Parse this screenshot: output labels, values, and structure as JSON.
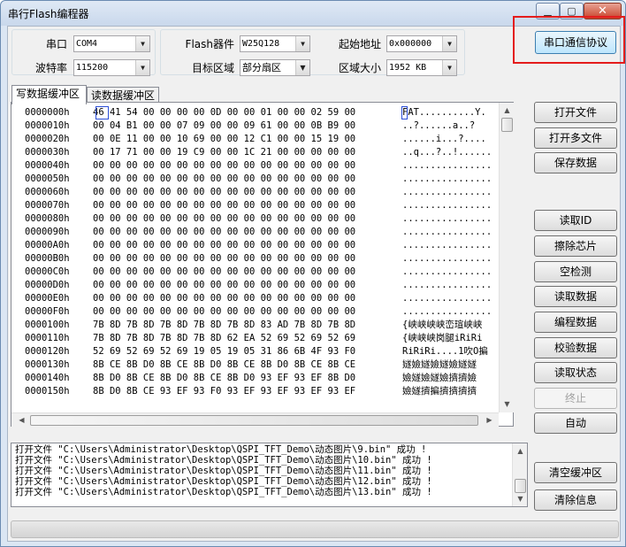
{
  "window": {
    "title": "串行Flash编程器",
    "min_icon": "minimize-icon",
    "max_icon": "maximize-icon",
    "close_icon": "close-icon",
    "min_glyph": "▁",
    "max_glyph": "▢",
    "close_glyph": "✕"
  },
  "settings": {
    "port_label": "串口",
    "port_value": "COM4",
    "baud_label": "波特率",
    "baud_value": "115200",
    "device_label": "Flash器件",
    "device_value": "W25Q128",
    "target_label": "目标区域",
    "target_value": "部分扇区",
    "start_label": "起始地址",
    "start_value": "0x000000",
    "size_label": "区域大小",
    "size_value": "1952 KB"
  },
  "protocol_button": "串口通信协议",
  "tabs": {
    "write_buffer": "写数据缓冲区",
    "read_buffer": "读数据缓冲区"
  },
  "hex_rows": [
    {
      "addr": "0000000h",
      "hex": "46 41 54 00 00 00 00 0D 00 00 01 00 00 02 59 00",
      "ascii": "FAT..........Y."
    },
    {
      "addr": "0000010h",
      "hex": "00 04 B1 00 00 07 09 00 00 09 61 00 00 0B B9 00",
      "ascii": "..?......a..?"
    },
    {
      "addr": "0000020h",
      "hex": "00 0E 11 00 00 10 69 00 00 12 C1 00 00 15 19 00",
      "ascii": "......i...?...."
    },
    {
      "addr": "0000030h",
      "hex": "00 17 71 00 00 19 C9 00 00 1C 21 00 00 00 00 00",
      "ascii": "..q...?..!......"
    },
    {
      "addr": "0000040h",
      "hex": "00 00 00 00 00 00 00 00 00 00 00 00 00 00 00 00",
      "ascii": "................"
    },
    {
      "addr": "0000050h",
      "hex": "00 00 00 00 00 00 00 00 00 00 00 00 00 00 00 00",
      "ascii": "................"
    },
    {
      "addr": "0000060h",
      "hex": "00 00 00 00 00 00 00 00 00 00 00 00 00 00 00 00",
      "ascii": "................"
    },
    {
      "addr": "0000070h",
      "hex": "00 00 00 00 00 00 00 00 00 00 00 00 00 00 00 00",
      "ascii": "................"
    },
    {
      "addr": "0000080h",
      "hex": "00 00 00 00 00 00 00 00 00 00 00 00 00 00 00 00",
      "ascii": "................"
    },
    {
      "addr": "0000090h",
      "hex": "00 00 00 00 00 00 00 00 00 00 00 00 00 00 00 00",
      "ascii": "................"
    },
    {
      "addr": "00000A0h",
      "hex": "00 00 00 00 00 00 00 00 00 00 00 00 00 00 00 00",
      "ascii": "................"
    },
    {
      "addr": "00000B0h",
      "hex": "00 00 00 00 00 00 00 00 00 00 00 00 00 00 00 00",
      "ascii": "................"
    },
    {
      "addr": "00000C0h",
      "hex": "00 00 00 00 00 00 00 00 00 00 00 00 00 00 00 00",
      "ascii": "................"
    },
    {
      "addr": "00000D0h",
      "hex": "00 00 00 00 00 00 00 00 00 00 00 00 00 00 00 00",
      "ascii": "................"
    },
    {
      "addr": "00000E0h",
      "hex": "00 00 00 00 00 00 00 00 00 00 00 00 00 00 00 00",
      "ascii": "................"
    },
    {
      "addr": "00000F0h",
      "hex": "00 00 00 00 00 00 00 00 00 00 00 00 00 00 00 00",
      "ascii": "................"
    },
    {
      "addr": "0000100h",
      "hex": "7B 8D 7B 8D 7B 8D 7B 8D 7B 8D 83 AD 7B 8D 7B 8D",
      "ascii": "{峡峡峡峡峦瑄峡峡"
    },
    {
      "addr": "0000110h",
      "hex": "7B 8D 7B 8D 7B 8D 7B 8D 62 EA 52 69 52 69 52 69",
      "ascii": "{峡峡峡岗腿iRiRi"
    },
    {
      "addr": "0000120h",
      "hex": "52 69 52 69 52 69 19 05 19 05 31 86 6B 4F 93 F0",
      "ascii": "RiRiRi....1吹O揙"
    },
    {
      "addr": "0000130h",
      "hex": "8B CE 8B D0 8B CE 8B D0 8B CE 8B D0 8B CE 8B CE",
      "ascii": "嬘嬐嬘嬐嬘嬐嬘嬘"
    },
    {
      "addr": "0000140h",
      "hex": "8B D0 8B CE 8B D0 8B CE 8B D0 93 EF 93 EF 8B D0",
      "ascii": "嬐嬘嬐嬘嬐擠擠嬐"
    },
    {
      "addr": "0000150h",
      "hex": "8B D0 8B CE 93 EF 93 F0 93 EF 93 EF 93 EF 93 EF",
      "ascii": "嬐嬘擠揙擠擠擠擠"
    }
  ],
  "side_buttons": {
    "open_file": "打开文件",
    "open_multi": "打开多文件",
    "save_data": "保存数据",
    "read_id": "读取ID",
    "erase_chip": "擦除芯片",
    "blank_check": "空检测",
    "read_data": "读取数据",
    "program_data": "编程数据",
    "verify_data": "校验数据",
    "read_status": "读取状态",
    "stop": "终止",
    "auto": "自动",
    "clear_buffer": "清空缓冲区",
    "clear_info": "清除信息"
  },
  "log_lines": [
    "打开文件 \"C:\\Users\\Administrator\\Desktop\\QSPI_TFT_Demo\\动态图片\\9.bin\" 成功 !",
    "打开文件 \"C:\\Users\\Administrator\\Desktop\\QSPI_TFT_Demo\\动态图片\\10.bin\" 成功 !",
    "打开文件 \"C:\\Users\\Administrator\\Desktop\\QSPI_TFT_Demo\\动态图片\\11.bin\" 成功 !",
    "打开文件 \"C:\\Users\\Administrator\\Desktop\\QSPI_TFT_Demo\\动态图片\\12.bin\" 成功 !",
    "打开文件 \"C:\\Users\\Administrator\\Desktop\\QSPI_TFT_Demo\\动态图片\\13.bin\" 成功 !"
  ],
  "highlight_color": "#e41c1c",
  "progress": 0
}
